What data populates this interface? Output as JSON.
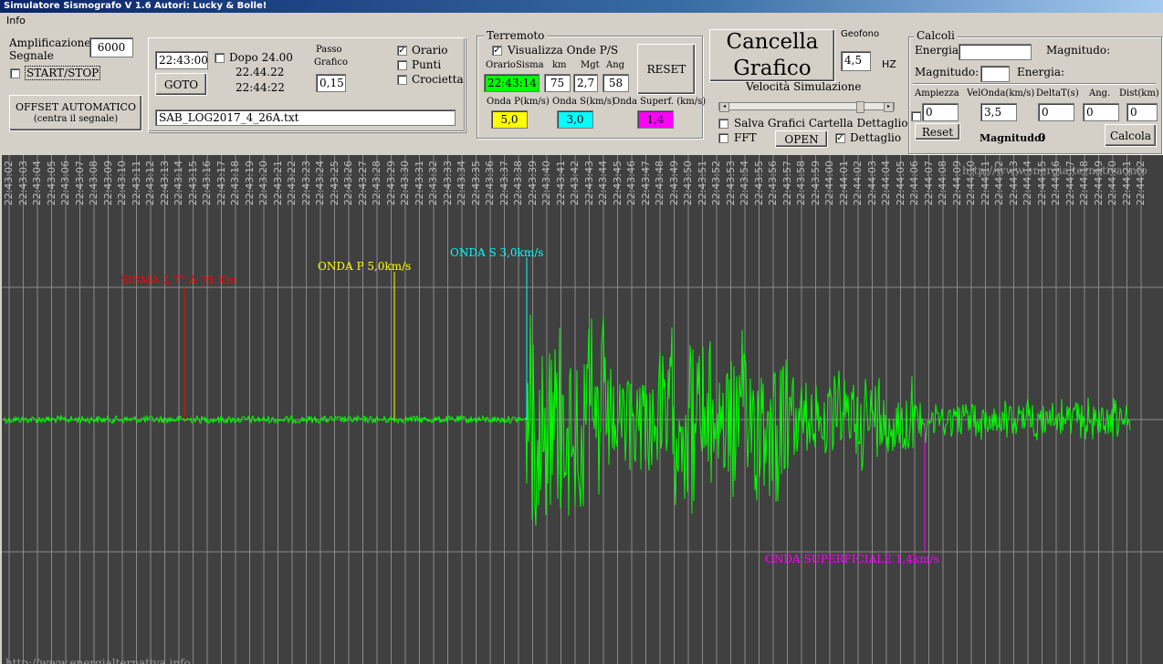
{
  "window": {
    "title": "Simulatore Sismografo V 1.6  Autori: Lucky & Bolle!"
  },
  "menu": [
    "Info"
  ],
  "amplification": {
    "label": "Amplificazione Segnale",
    "value": "6000",
    "start_stop": "START/STOP"
  },
  "offset_button": {
    "line1": "OFFSET AUTOMATICO",
    "line2": "(centra il segnale)"
  },
  "time": {
    "goto_value": "22:43:00",
    "dopo_label": "Dopo 24.00",
    "time1": "22.44.22",
    "time2": "22:44:22",
    "goto_label": "GOTO",
    "passo_label1": "Passo",
    "passo_label2": "Grafico",
    "passo_value": "0,15",
    "file": "SAB_LOG2017_4_26A.txt"
  },
  "options": {
    "orario": "Orario",
    "punti": "Punti",
    "crocietta": "Crocietta"
  },
  "terremoto": {
    "legend": "Terremoto",
    "show_waves": "Visualizza Onde P/S",
    "headers": {
      "orario": "OrarioSisma",
      "km": "km",
      "mgt": "Mgt",
      "ang": "Ang"
    },
    "values": {
      "orario": "22:43:14",
      "km": "75",
      "mgt": "2,7",
      "ang": "58"
    },
    "reset": "RESET",
    "onda_p_label": "Onda P(km/s)",
    "onda_s_label": "Onda S(km/s)",
    "onda_sup_label": "Onda Superf. (km/s)",
    "onda_p": "5,0",
    "onda_s": "3,0",
    "onda_sup": "1,4",
    "color_p": "#ffff00",
    "color_s": "#00ffff",
    "color_sup": "#ff00ff",
    "color_orario": "#00ff00"
  },
  "cancella": {
    "line1": "Cancella",
    "line2": "Grafico",
    "geofono_label": "Geofono",
    "geofono_value": "4,5",
    "hz": "HZ",
    "velocita": "Velocità Simulazione",
    "salva": "Salva Grafici Cartella Dettaglio",
    "fft": "FFT",
    "open": "OPEN",
    "dettaglio": "Dettaglio"
  },
  "calcoli": {
    "legend": "Calcoli",
    "energia": "Energia",
    "magnitudo": "Magnitudo:",
    "magnitudo2": "Magnitudo:",
    "energia2": "Energia:",
    "headers": [
      "Ampiezza",
      "VelOnda(km/s)",
      "DeltaT(s)",
      "Ang.",
      "Dist(km)"
    ],
    "values": [
      "0",
      "3,5",
      "0",
      "0",
      "0"
    ],
    "reset": "Reset",
    "mag_result_label": "Magnitudo:",
    "mag_result": "0",
    "calcola": "Calcola"
  },
  "plot": {
    "watermark": "http://www.energialternativa.info",
    "watermark_bottom": "http://www.energialternativa.info",
    "ticks": [
      "22:43:02",
      "22:43:03",
      "22:43:04",
      "22:43:05",
      "22:43:06",
      "22:43:07",
      "22:43:08",
      "22:43:09",
      "22:43:10",
      "22:43:11",
      "22:43:12",
      "22:43:13",
      "22:43:14",
      "22:43:15",
      "22:43:16",
      "22:43:17",
      "22:43:18",
      "22:43:19",
      "22:43:20",
      "22:43:21",
      "22:43:22",
      "22:43:23",
      "22:43:24",
      "22:43:25",
      "22:43:26",
      "22:43:27",
      "22:43:28",
      "22:43:29",
      "22:43:30",
      "22:43:31",
      "22:43:32",
      "22:43:33",
      "22:43:34",
      "22:43:35",
      "22:43:36",
      "22:43:37",
      "22:43:38",
      "22:43:39",
      "22:43:40",
      "22:43:41",
      "22:43:42",
      "22:43:43",
      "22:43:44",
      "22:43:45",
      "22:43:46",
      "22:43:47",
      "22:43:48",
      "22:43:49",
      "22:43:50",
      "22:43:51",
      "22:43:52",
      "22:43:53",
      "22:43:54",
      "22:43:55",
      "22:43:56",
      "22:43:57",
      "22:43:58",
      "22:43:59",
      "22:44:00",
      "22:44:01",
      "22:44:02",
      "22:44:03",
      "22:44:04",
      "22:44:05",
      "22:44:06",
      "22:44:07",
      "22:44:08",
      "22:44:09",
      "22:44:10",
      "22:44:11",
      "22:44:12",
      "22:44:13",
      "22:44:14",
      "22:44:15",
      "22:44:16",
      "22:44:17",
      "22:44:18",
      "22:44:19",
      "22:44:20",
      "22:44:21",
      "22:44:22"
    ],
    "markers": {
      "sisma": "SISMA 2,7° A 75 Km",
      "onda_p": "ONDA P 5,0km/s",
      "onda_s": "ONDA S 3,0km/s",
      "onda_sup": "ONDA SUPERFICIALE 1,4km/s"
    },
    "colors": {
      "background": "#404040",
      "signal": "#00ff00",
      "grid": "#8a8a8a",
      "sisma": "#ff0000"
    }
  }
}
